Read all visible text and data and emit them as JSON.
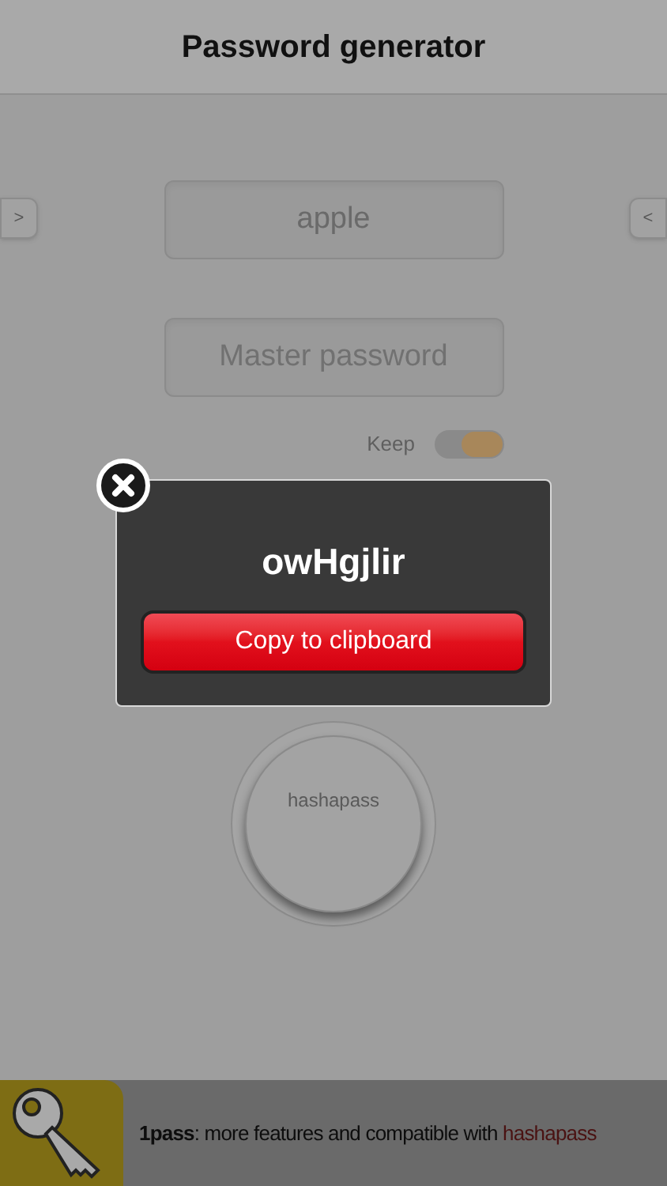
{
  "header": {
    "title": "Password generator"
  },
  "left_tab": {
    "label": ">"
  },
  "right_tab": {
    "label": "<"
  },
  "site_field": {
    "value": "apple"
  },
  "master_field": {
    "placeholder": "Master password"
  },
  "keep": {
    "label": "Keep",
    "on": true
  },
  "popup": {
    "password": "owHgjlir",
    "button": "Copy to clipboard"
  },
  "hash_button": {
    "label": "hashapass"
  },
  "banner": {
    "text": "**1pass**: more features and compatible with ",
    "highlight": "hashapass"
  }
}
